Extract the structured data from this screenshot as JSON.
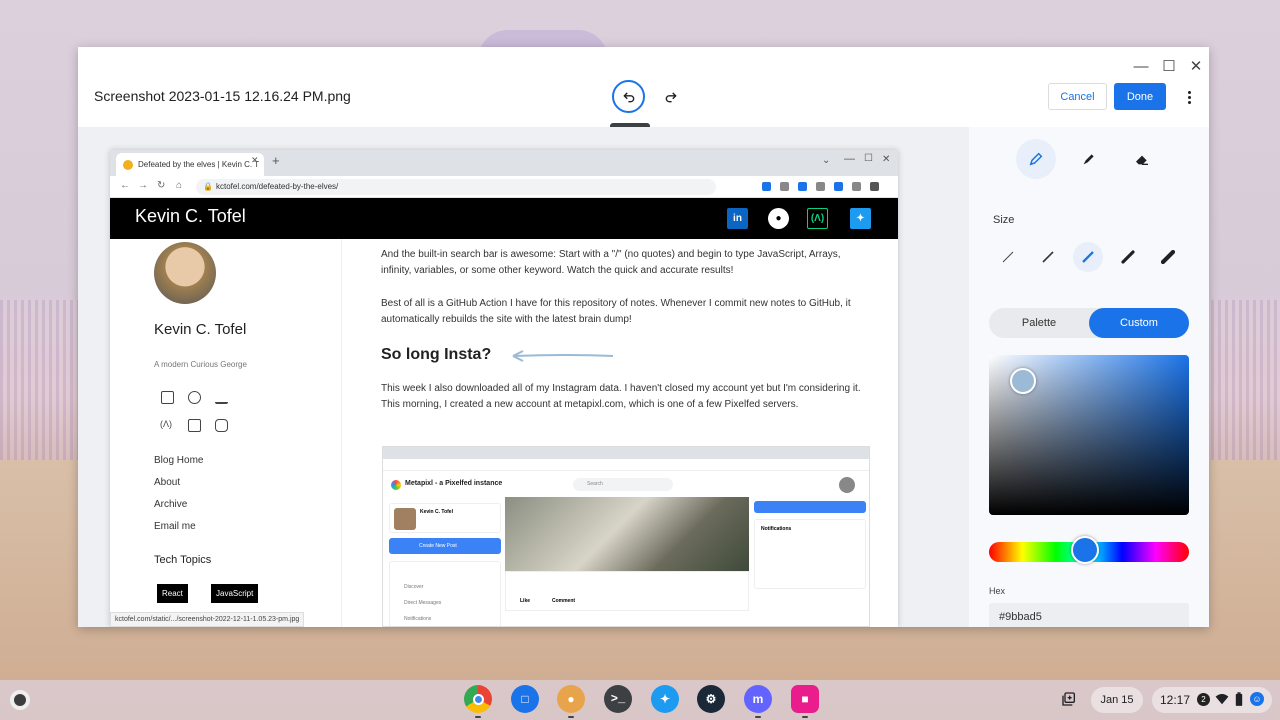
{
  "window": {
    "file_name": "Screenshot 2023-01-15 12.16.24 PM.png",
    "undo_tooltip": "Undo",
    "cancel_label": "Cancel",
    "done_label": "Done"
  },
  "browser": {
    "tab_title": "Defeated by the elves | Kevin C. T",
    "url": "kctofel.com/defeated-by-the-elves/",
    "site_title": "Kevin C. Tofel",
    "status_url": "kctofel.com/static/.../screenshot-2022-12-11-1.05.23-pm.jpg"
  },
  "blog_sidebar": {
    "name": "Kevin C. Tofel",
    "tagline": "A modern Curious George",
    "links": [
      "Blog Home",
      "About",
      "Archive",
      "Email me"
    ],
    "topics_heading": "Tech Topics",
    "tags": [
      "React",
      "JavaScript"
    ]
  },
  "article": {
    "para1": "And the built-in search bar is awesome: Start with a \"/\" (no quotes) and begin to type JavaScript, Arrays, infinity, variables, or some other keyword. Watch the quick and accurate results!",
    "para2": "Best of all is a GitHub Action I have for this repository of notes. Whenever I commit new notes to GitHub, it automatically rebuilds the site with the latest brain dump!",
    "heading": "So long Insta?",
    "para3": "This week I also downloaded all of my Instagram data. I haven't closed my account yet but I'm considering it. This morning, I created a new account at metapixl.com, which is one of a few Pixelfed servers."
  },
  "embedded": {
    "site_name": "Metapixl - a Pixelfed instance",
    "search_placeholder": "Search",
    "user_name": "Kevin C. Tofel",
    "new_post": "Create New Post",
    "nav": [
      "Discover",
      "Direct Messages",
      "Notifications"
    ],
    "notifications_title": "Notifications",
    "actions": [
      "Like",
      "Comment"
    ]
  },
  "editor": {
    "size_label": "Size",
    "palette_label": "Palette",
    "custom_label": "Custom",
    "hex_label": "Hex",
    "hex_value": "#9bbad5",
    "accent": "#1a73e8"
  },
  "shelf": {
    "date": "Jan 15",
    "time": "12:17",
    "notification_count": "2",
    "apps": [
      "chrome-icon",
      "files-icon",
      "app-icon",
      "terminal-icon",
      "twitter-icon",
      "steam-icon",
      "mastodon-icon",
      "screenshot-icon"
    ]
  }
}
